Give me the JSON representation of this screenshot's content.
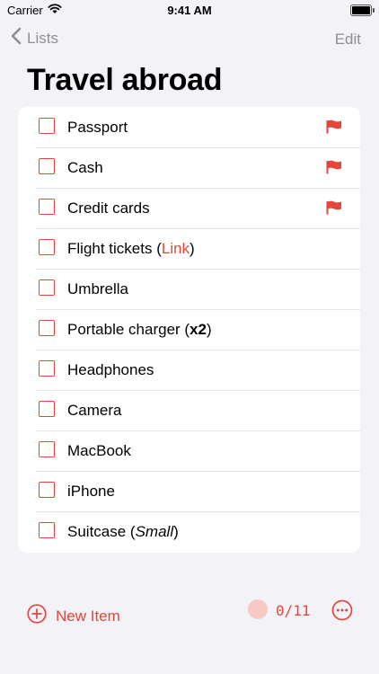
{
  "status": {
    "carrier": "Carrier",
    "time": "9:41 AM"
  },
  "nav": {
    "back_label": "Lists",
    "edit_label": "Edit"
  },
  "title": "Travel abroad",
  "items": [
    {
      "text": "Passport",
      "flagged": true
    },
    {
      "text": "Cash",
      "flagged": true
    },
    {
      "text": "Credit cards",
      "flagged": true
    },
    {
      "text_before": "Flight tickets (",
      "link": "Link",
      "text_after": ")"
    },
    {
      "text": "Umbrella"
    },
    {
      "text_before": "Portable charger (",
      "bold": "x2",
      "text_after": ")"
    },
    {
      "text": "Headphones"
    },
    {
      "text": "Camera"
    },
    {
      "text": "MacBook"
    },
    {
      "text": "iPhone"
    },
    {
      "text_before": "Suitcase (",
      "italic": "Small",
      "text_after": ")"
    }
  ],
  "footer": {
    "new_item_label": "New Item",
    "counter": "0/11"
  },
  "colors": {
    "accent": "#e5453a",
    "background": "#f2f2f7",
    "card": "#ffffff"
  }
}
